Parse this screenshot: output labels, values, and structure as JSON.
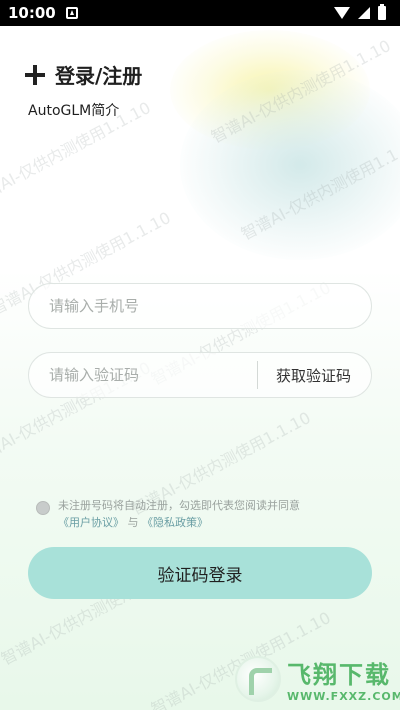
{
  "status_bar": {
    "time": "10:00",
    "icons": [
      "notification-icon",
      "wifi-icon",
      "signal-icon",
      "battery-icon"
    ]
  },
  "header": {
    "title": "登录/注册",
    "intro_link": "AutoGLM简介"
  },
  "watermark": {
    "text": "智谱AI-仅供内测使用1.1.10"
  },
  "form": {
    "phone_placeholder": "请输入手机号",
    "code_placeholder": "请输入验证码",
    "get_code_label": "获取验证码"
  },
  "agreement": {
    "text": "未注册号码将自动注册，勾选即代表您阅读并同意",
    "user_agreement": "《用户协议》",
    "joiner": "与",
    "privacy_policy": "《隐私政策》"
  },
  "login_button": {
    "label": "验证码登录"
  },
  "logo_banner": {
    "name": "飞翔下载",
    "url": "WWW.FXXZ.COM"
  },
  "colors": {
    "button_fill": "#a8e1d9",
    "logo_green": "#58b86c",
    "link_color": "#6a9ea4"
  }
}
